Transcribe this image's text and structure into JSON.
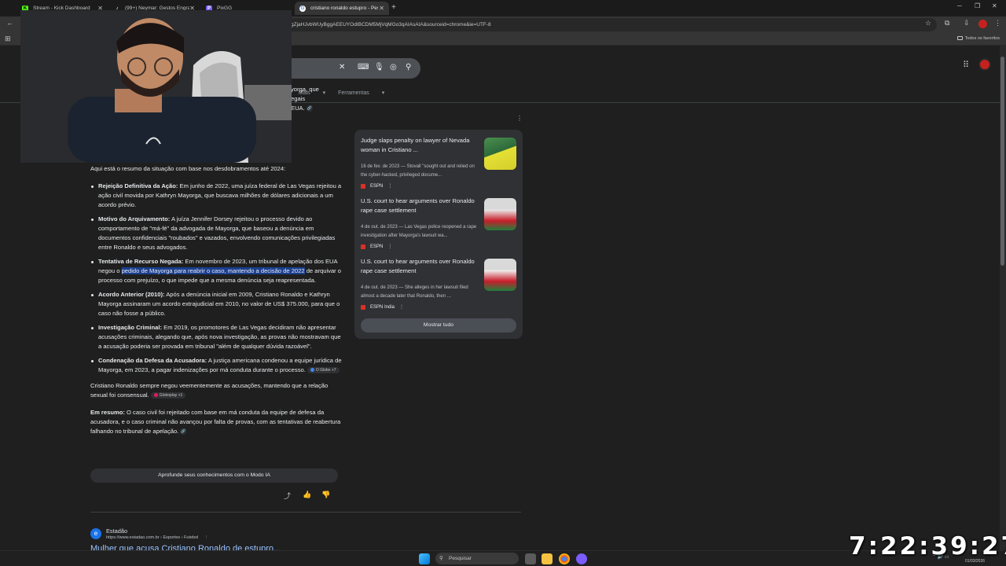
{
  "tabs": [
    {
      "title": "Stream - Kick Dashboard",
      "icon": "K",
      "color": "#53fc18"
    },
    {
      "title": "(99+) Neymar: Gestos Engraçados",
      "icon": "♪",
      "color": "#ffffff"
    },
    {
      "title": "PixGG",
      "icon": "P",
      "color": "#7a5cff"
    },
    {
      "title": "cristiano ronaldo estupro - Pesq",
      "icon": "G",
      "color": "#4285f4"
    }
  ],
  "url_visible": "gZjaHJvbWUyBggAEEUYOdIBCDM5MjVqMGo3qAIAsAIA&sourceid=chrome&ie=UTF-8",
  "bookmarks": {
    "all_label": "Todos os favoritos"
  },
  "search_tabs": [
    "g",
    "Mais",
    "Ferramentas"
  ],
  "ai_overview": {
    "partial_lines": [
      "yorga, que",
      "egais",
      "EUA."
    ],
    "intro": "Aqui está o resumo da situação com base nos desdobramentos até 2024:",
    "bullets": [
      {
        "bold": "Rejeição Definitiva da Ação:",
        "text": " Em junho de 2022, uma juíza federal de Las Vegas rejeitou a ação civil movida por Kathryn Mayorga, que buscava milhões de dólares adicionais a um acordo prévio."
      },
      {
        "bold": "Motivo do Arquivamento:",
        "text": " A juíza Jennifer Dorsey rejeitou o processo devido ao comportamento de \"má-fé\" da advogada de Mayorga, que baseou a denúncia em documentos confidenciais \"roubados\" e vazados, envolvendo comunicações privilegiadas entre Ronaldo e seus advogados."
      },
      {
        "bold": "Tentativa de Recurso Negada:",
        "pre": " Em novembro de 2023, um tribunal de apelação dos EUA negou o ",
        "highlight": "pedido de Mayorga para reabrir o caso, mantendo a decisão de 2022",
        "post": " de arquivar o processo com prejuízo, o que impede que a mesma denúncia seja reapresentada."
      },
      {
        "bold": "Acordo Anterior (2010):",
        "text": " Após a denúncia inicial em 2009, Cristiano Ronaldo e Kathryn Mayorga assinaram um acordo extrajudicial em 2010, no valor de US$ 375.000, para que o caso não fosse a público."
      },
      {
        "bold": "Investigação Criminal:",
        "text": " Em 2019, os promotores de Las Vegas decidiram não apresentar acusações criminais, alegando que, após nova investigação, as provas não mostravam que a acusação poderia ser provada em tribunal \"além de qualquer dúvida razoável\"."
      },
      {
        "bold": "Condenação da Defesa da Acusadora:",
        "text": " A justiça americana condenou a equipe jurídica de Mayorga, em 2023, a pagar indenizações por má conduta durante o processo.",
        "chip": "O Globo +7"
      }
    ],
    "para1": "Cristiano Ronaldo sempre negou veementemente as acusações, mantendo que a relação sexual foi consensual.",
    "para1_chip": "Globoplay +1",
    "summary_bold": "Em resumo:",
    "summary_text": " O caso civil foi rejeitado com base em má conduta da equipe de defesa da acusadora, e o caso criminal não avançou por falta de provas, com as tentativas de reabertura falhando no tribunal de apelação.",
    "deep_dive": "Aprofunde seus conhecimentos com o Modo IA"
  },
  "sources": [
    {
      "title": "Judge slaps penalty on lawyer of Nevada woman in Cristiano ...",
      "snippet": "16 de fev. de 2023 — Stovall \"sought out and relied on the cyber-hacked, privileged docume...",
      "site": "ESPN"
    },
    {
      "title": "U.S. court to hear arguments over Ronaldo rape case settlement",
      "snippet": "4 de out. de 2023 — Las Vegas police reopened a rape investigation after Mayorga's lawsuit wa...",
      "site": "ESPN"
    },
    {
      "title": "U.S. court to hear arguments over Ronaldo rape case settlement",
      "snippet": "4 de out. de 2023 — She alleges in her lawsuit filed almost a decade later that Ronaldo, then ...",
      "site": "ESPN India"
    }
  ],
  "show_all": "Mostrar tudo",
  "result": {
    "favicon": "e",
    "site": "Estadão",
    "url": "https://www.estadao.com.br › Esportes › Futebol",
    "title": "Mulher que acusa Cristiano Ronaldo de estupro..."
  },
  "taskbar": {
    "search_placeholder": "Pesquisar",
    "date": "01/03/2026"
  },
  "timer": "7:22:39:27"
}
